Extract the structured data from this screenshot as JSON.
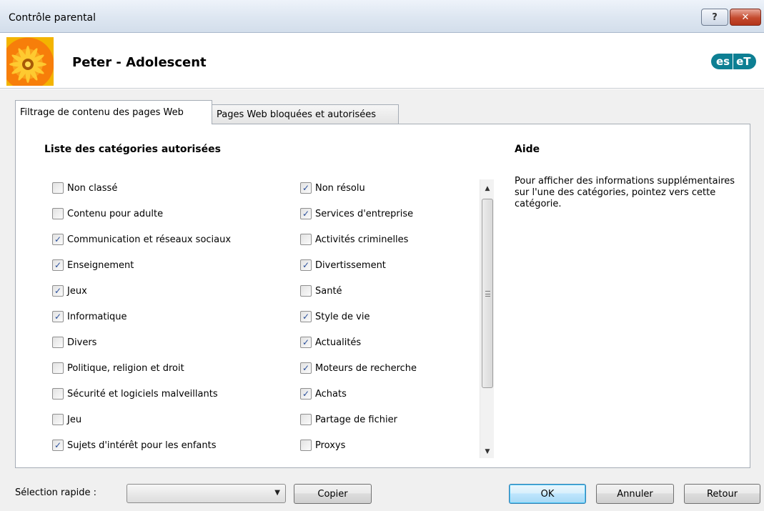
{
  "window": {
    "title": "Contrôle parental",
    "help_label": "?",
    "close_label": "✕"
  },
  "header": {
    "profile_name": "Peter - Adolescent",
    "logo_left": "es",
    "logo_right": "eT"
  },
  "tabs": [
    {
      "label": "Filtrage de contenu des pages Web",
      "active": true
    },
    {
      "label": "Pages Web bloquées et autorisées",
      "active": false
    }
  ],
  "list": {
    "title": "Liste des catégories autorisées",
    "column1": [
      {
        "label": "Non classé",
        "checked": false
      },
      {
        "label": "Contenu pour adulte",
        "checked": false
      },
      {
        "label": "Communication et réseaux sociaux",
        "checked": true
      },
      {
        "label": "Enseignement",
        "checked": true
      },
      {
        "label": "Jeux",
        "checked": true
      },
      {
        "label": "Informatique",
        "checked": true
      },
      {
        "label": "Divers",
        "checked": false
      },
      {
        "label": "Politique, religion et droit",
        "checked": false
      },
      {
        "label": "Sécurité et logiciels malveillants",
        "checked": false
      },
      {
        "label": "Jeu",
        "checked": false
      },
      {
        "label": "Sujets d'intérêt pour les enfants",
        "checked": true
      }
    ],
    "column2": [
      {
        "label": "Non résolu",
        "checked": true
      },
      {
        "label": "Services d'entreprise",
        "checked": true
      },
      {
        "label": "Activités criminelles",
        "checked": false
      },
      {
        "label": "Divertissement",
        "checked": true
      },
      {
        "label": "Santé",
        "checked": false
      },
      {
        "label": "Style de vie",
        "checked": true
      },
      {
        "label": "Actualités",
        "checked": true
      },
      {
        "label": "Moteurs de recherche",
        "checked": true
      },
      {
        "label": "Achats",
        "checked": true
      },
      {
        "label": "Partage de fichier",
        "checked": false
      },
      {
        "label": "Proxys",
        "checked": false
      }
    ]
  },
  "help": {
    "title": "Aide",
    "text": "Pour afficher des informations supplémentaires sur l'une des catégories, pointez vers cette catégorie."
  },
  "footer": {
    "quick_select_label": "Sélection rapide :",
    "quick_select_value": "",
    "copy_label": "Copier",
    "ok_label": "OK",
    "cancel_label": "Annuler",
    "back_label": "Retour"
  },
  "colors": {
    "accent": "#0d7f93",
    "checkmark": "#2a4f9a"
  }
}
